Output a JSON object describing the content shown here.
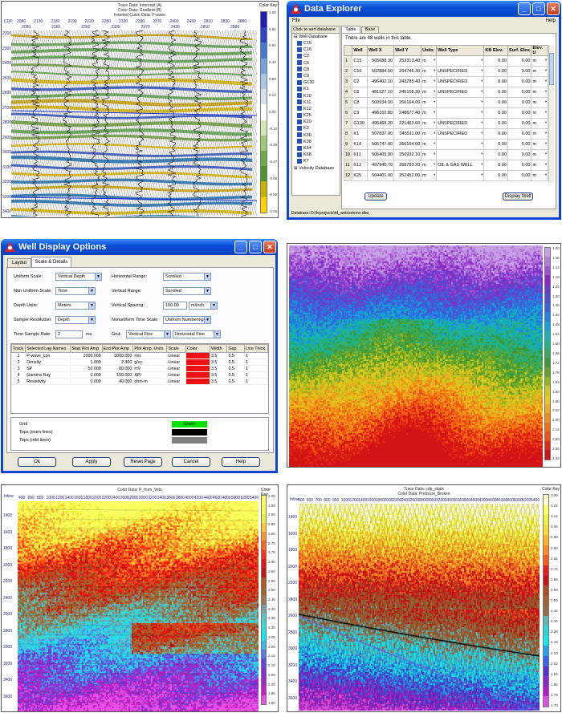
{
  "p1": {
    "titles": [
      "Trace Data: Intercept (A)",
      "Color Data: Gradient (B)",
      "Inserted Curve Data: P-wave"
    ],
    "cdp_label": "CDP",
    "cdp_row1": [
      "2080",
      "2130",
      "2180",
      "2190",
      "2220",
      "2280",
      "2320",
      "2330",
      "2370",
      "2400",
      "2460",
      "2810",
      "2830",
      "2880"
    ],
    "cdp_row2": [
      "2090",
      "2160",
      "2260",
      "2300",
      "2370",
      "2430",
      "2810",
      "2880"
    ],
    "y_ticks": [
      "2200",
      "2300",
      "2400",
      "2500",
      "2600",
      "2700",
      "2800",
      "2900",
      "3000",
      "3100",
      "3200",
      "3300",
      "3400"
    ],
    "colorbar_title": "Color Key",
    "colorbar_ticks": [
      "1.00",
      "0.82",
      "0.64",
      "0.47",
      "0.29",
      "0.12",
      "0.00",
      "-0.12",
      "-0.29",
      "-0.47",
      "-0.65",
      "-0.82",
      "-1.00"
    ],
    "colorbar_colors": [
      "#1e1eb4",
      "#2d46c8",
      "#4678d2",
      "#78a0dc",
      "#aac8e6",
      "#d2e1ec",
      "#ffffff",
      "#d7e6b4",
      "#a0c878",
      "#6eaa4b",
      "#509132",
      "#c8b400",
      "#ffd200"
    ]
  },
  "p2": {
    "title": "Data Explorer",
    "menu_file": "File",
    "menu_help": "Help",
    "sort_label": "Click to sort database",
    "tab_table": "Table View",
    "tab_base": "Base Map",
    "info": "There are 48 wells in this table.",
    "tree_root": "Well Database",
    "tree_items": [
      "C15",
      "C16",
      "C2",
      "C6",
      "C8",
      "C9",
      "G130",
      "K1",
      "K10",
      "K11",
      "K12",
      "K25",
      "K29",
      "K3",
      "K30",
      "K38",
      "K64",
      "K68",
      "K7"
    ],
    "tree_velocity": "Velocity Database",
    "columns": [
      "",
      "Well",
      "Well X",
      "Well Y",
      "Units",
      "Well Type",
      "KB Elev.",
      "Surf. Elev.",
      "Elev. U"
    ],
    "rows": [
      [
        "1",
        "C15",
        "505688.30",
        "253313.40",
        "m",
        "",
        "0.00",
        "0.00",
        "m"
      ],
      [
        "2",
        "C16",
        "502884.50",
        "264746.30",
        "m",
        "UNSPECIFIED",
        "0.00",
        "0.00",
        "m"
      ],
      [
        "3",
        "C2",
        "496402.10",
        "243785.40",
        "m",
        "UNSPECIFIED",
        "0.00",
        "0.00",
        "m"
      ],
      [
        "4",
        "C6",
        "491527.10",
        "245108.30",
        "m",
        "UNSPECIFIED",
        "0.00",
        "0.00",
        "m"
      ],
      [
        "5",
        "C8",
        "500934.00",
        "266164.00",
        "m",
        "",
        "0.00",
        "0.00",
        "m"
      ],
      [
        "6",
        "C9",
        "496162.80",
        "248677.40",
        "m",
        "",
        "0.00",
        "0.00",
        "m"
      ],
      [
        "7",
        "G130",
        "496468.20",
        "221463.60",
        "m",
        "UNSPECIFIED",
        "0.00",
        "0.00",
        "m"
      ],
      [
        "8",
        "K1",
        "507837.00",
        "245511.00",
        "m",
        "UNSPECIFIED",
        "0.00",
        "0.00",
        "m"
      ],
      [
        "9",
        "K10",
        "506747.00",
        "256164.00",
        "m",
        "",
        "0.00",
        "0.00",
        "m"
      ],
      [
        "10",
        "K11",
        "506405.00",
        "256932.10",
        "m",
        "",
        "0.00",
        "0.00",
        "m"
      ],
      [
        "11",
        "K12",
        "497946.70",
        "258783.20",
        "m",
        "OIL & GAS WELL",
        "0.00",
        "0.00",
        "m"
      ],
      [
        "12",
        "K25",
        "504401.00",
        "252452.00",
        "m",
        "",
        "0.00",
        "0.00",
        "m"
      ]
    ],
    "btn_update": "Update",
    "btn_display": "Display Well",
    "status": "Database: D:\\hrprojects\\td_web\\cdemo.dbo"
  },
  "p3": {
    "title": "Well Display Options",
    "tab_layout": "Layout",
    "tab_scale": "Scale & Details",
    "uniform_scale_label": "Uniform Scale:",
    "uniform_scale_value": "Vertical Depth",
    "non_uniform_label": "Non Uniform Scale:",
    "non_uniform_value": "Time",
    "depth_units_label": "Depth Units:",
    "depth_units_value": "Meters",
    "sample_res_label": "Sample Resolution:",
    "sample_res_value": "Depth",
    "time_rate_label": "Time Sample Rate:",
    "time_rate_value": "2",
    "time_rate_unit": "ms",
    "h_range_label": "Horizontal Range:",
    "h_range_value": "Scrolled",
    "v_range_label": "Vertical Range:",
    "v_range_value": "Scrolled",
    "v_spacing_label": "Vertical Spacing:",
    "v_spacing_value": "100.00",
    "v_spacing_unit": "m/inch",
    "nonuni_time_label": "Nonuniform Time Scale:",
    "nonuni_time_value": "Uniform Numbering",
    "grid_label": "Grid:",
    "grid_v": "Vertical Fine",
    "grid_h": "Horizontal Fine",
    "columns": [
      "Track",
      "Selected Log Names",
      "Start Plot Amp",
      "End Plot Amp",
      "Plot Amp. Units",
      "Scale",
      "Color",
      "Width",
      "Gap",
      "Line Thick"
    ],
    "rows": [
      [
        "1",
        "P-wave_con",
        "2000.000",
        "5000.000",
        "m/s",
        "Linear",
        "Red",
        "3.5",
        "0.5",
        "1"
      ],
      [
        "2",
        "Density",
        "1.900",
        "2.300",
        "g/cc",
        "Linear",
        "Red",
        "3.5",
        "0.5",
        "1"
      ],
      [
        "3",
        "SP",
        "50.000",
        "80.000",
        "mV",
        "Linear",
        "Red",
        "3.5",
        "0.5",
        "1"
      ],
      [
        "4",
        "Gamma Ray",
        "0.000",
        "150.000",
        "API",
        "Linear",
        "Red",
        "3.5",
        "0.5",
        "1"
      ],
      [
        "5",
        "Resistivity",
        "0.000",
        "40.000",
        "ohm-m",
        "Linear",
        "Red",
        "3.5",
        "0.5",
        "1"
      ]
    ],
    "grid_rows": [
      {
        "label": "Grid",
        "swatch": "#00e000",
        "text": "Green"
      },
      {
        "label": "Tops (even lines)",
        "swatch": "#000000",
        "text": ""
      },
      {
        "label": "Tops (odd lines)",
        "swatch": "#808080",
        "text": ""
      }
    ],
    "btn_ok": "Ok",
    "btn_apply": "Apply",
    "btn_reset": "Reset Page",
    "btn_cancel": "Cancel",
    "btn_help": "Help"
  },
  "p4": {
    "colorbar_ticks": [
      "1.00",
      "1.06",
      "1.12",
      "1.18",
      "1.24",
      "1.30",
      "1.36",
      "1.42",
      "1.48",
      "1.54",
      "1.60",
      "1.66",
      "1.72",
      "1.78",
      "1.84",
      "1.90",
      "1.96",
      "2.02",
      "2.08",
      "2.14",
      "2.20",
      "2.26",
      "2.32"
    ],
    "colorbar_colors": [
      "#c8a0e6",
      "#b478dc",
      "#a050d2",
      "#8c28c8",
      "#6e3cc8",
      "#5050d2",
      "#3264dc",
      "#1e82e6",
      "#14a0dc",
      "#14b4b4",
      "#1eb48c",
      "#32aa5a",
      "#3c9632",
      "#64a028",
      "#96b41e",
      "#c8c81e",
      "#e6c81e",
      "#f0aa1e",
      "#f08c14",
      "#f06e14",
      "#f05014",
      "#e62814",
      "#d21414"
    ]
  },
  "p5": {
    "title": "Color Data: P_from_Velo",
    "x_label": "Inline",
    "x_ticks": [
      "400",
      "600",
      "800",
      "1000",
      "1200",
      "1400",
      "1600",
      "1800",
      "2000",
      "2200",
      "2400",
      "2600",
      "2800",
      "3000",
      "3200",
      "3400",
      "3600",
      "3800",
      "4000",
      "4200",
      "4400",
      "4600",
      "4800",
      "5000",
      "5200",
      "5400"
    ],
    "y_ticks": [
      "1400",
      "1600",
      "1800",
      "2000",
      "2200",
      "2400",
      "2600",
      "2800",
      "3000",
      "3200",
      "3400",
      "3600"
    ],
    "colorbar_title": "Color Key",
    "colorbar_ticks": [
      "3.00",
      "2.95",
      "2.90",
      "2.85",
      "2.80",
      "2.75",
      "2.70",
      "2.65",
      "2.60",
      "2.55",
      "2.50",
      "2.45",
      "2.40",
      "2.35",
      "2.30",
      "2.25",
      "2.20",
      "2.15",
      "2.10",
      "2.05",
      "2.00",
      "1.95",
      "1.90"
    ],
    "colorbar_colors": [
      "#ffff64",
      "#f5ff50",
      "#e6f03c",
      "#ffc832",
      "#ff9628",
      "#ff6420",
      "#ff3218",
      "#e61414",
      "#c81414",
      "#b45a1e",
      "#a06428",
      "#967850",
      "#78a0a0",
      "#50c8c8",
      "#32dcdc",
      "#14e6f0",
      "#3cb4f0",
      "#5a78e6",
      "#6446dc",
      "#8232d2",
      "#a028c8",
      "#c81ec8",
      "#e650e6"
    ]
  },
  "p6": {
    "titles": [
      "Trace Data: cdp_stack",
      "Color Data: Pressure_Broken"
    ],
    "x_label": "Inline",
    "x_ticks": [
      "400",
      "600",
      "700",
      "800",
      "900",
      "1000",
      "1200",
      "1400",
      "1600",
      "1800",
      "2000",
      "2200",
      "2400",
      "2600",
      "2800",
      "3000",
      "3200",
      "3400",
      "3600",
      "3800",
      "4000",
      "4200",
      "4400",
      "4600",
      "4800",
      "5000",
      "5200",
      "5400"
    ],
    "y_ticks": [
      "1400",
      "1600",
      "1800",
      "2000",
      "2200",
      "2400",
      "2600",
      "2800",
      "3000",
      "3200",
      "3400",
      "3600"
    ],
    "colorbar_title": "Color Key",
    "colorbar_ticks": [
      "3.30",
      "3.22",
      "3.14",
      "3.06",
      "2.98",
      "2.90",
      "2.82",
      "2.74",
      "2.66",
      "2.58",
      "2.50",
      "2.42",
      "2.34",
      "2.26",
      "2.18",
      "2.10",
      "2.02",
      "1.94",
      "1.86",
      "1.78",
      "1.70"
    ],
    "colorbar_colors": [
      "#ffffc8",
      "#ffff64",
      "#f0f03c",
      "#ffdc32",
      "#ffb428",
      "#ff8c28",
      "#ff5a1e",
      "#e61e1e",
      "#c81414",
      "#aa5028",
      "#a06432",
      "#966e46",
      "#64b4b4",
      "#32d2dc",
      "#14e6f0",
      "#28a0f0",
      "#3c64e6",
      "#5a32d2",
      "#8c28c8",
      "#b41ec8",
      "#dc50dc"
    ]
  }
}
